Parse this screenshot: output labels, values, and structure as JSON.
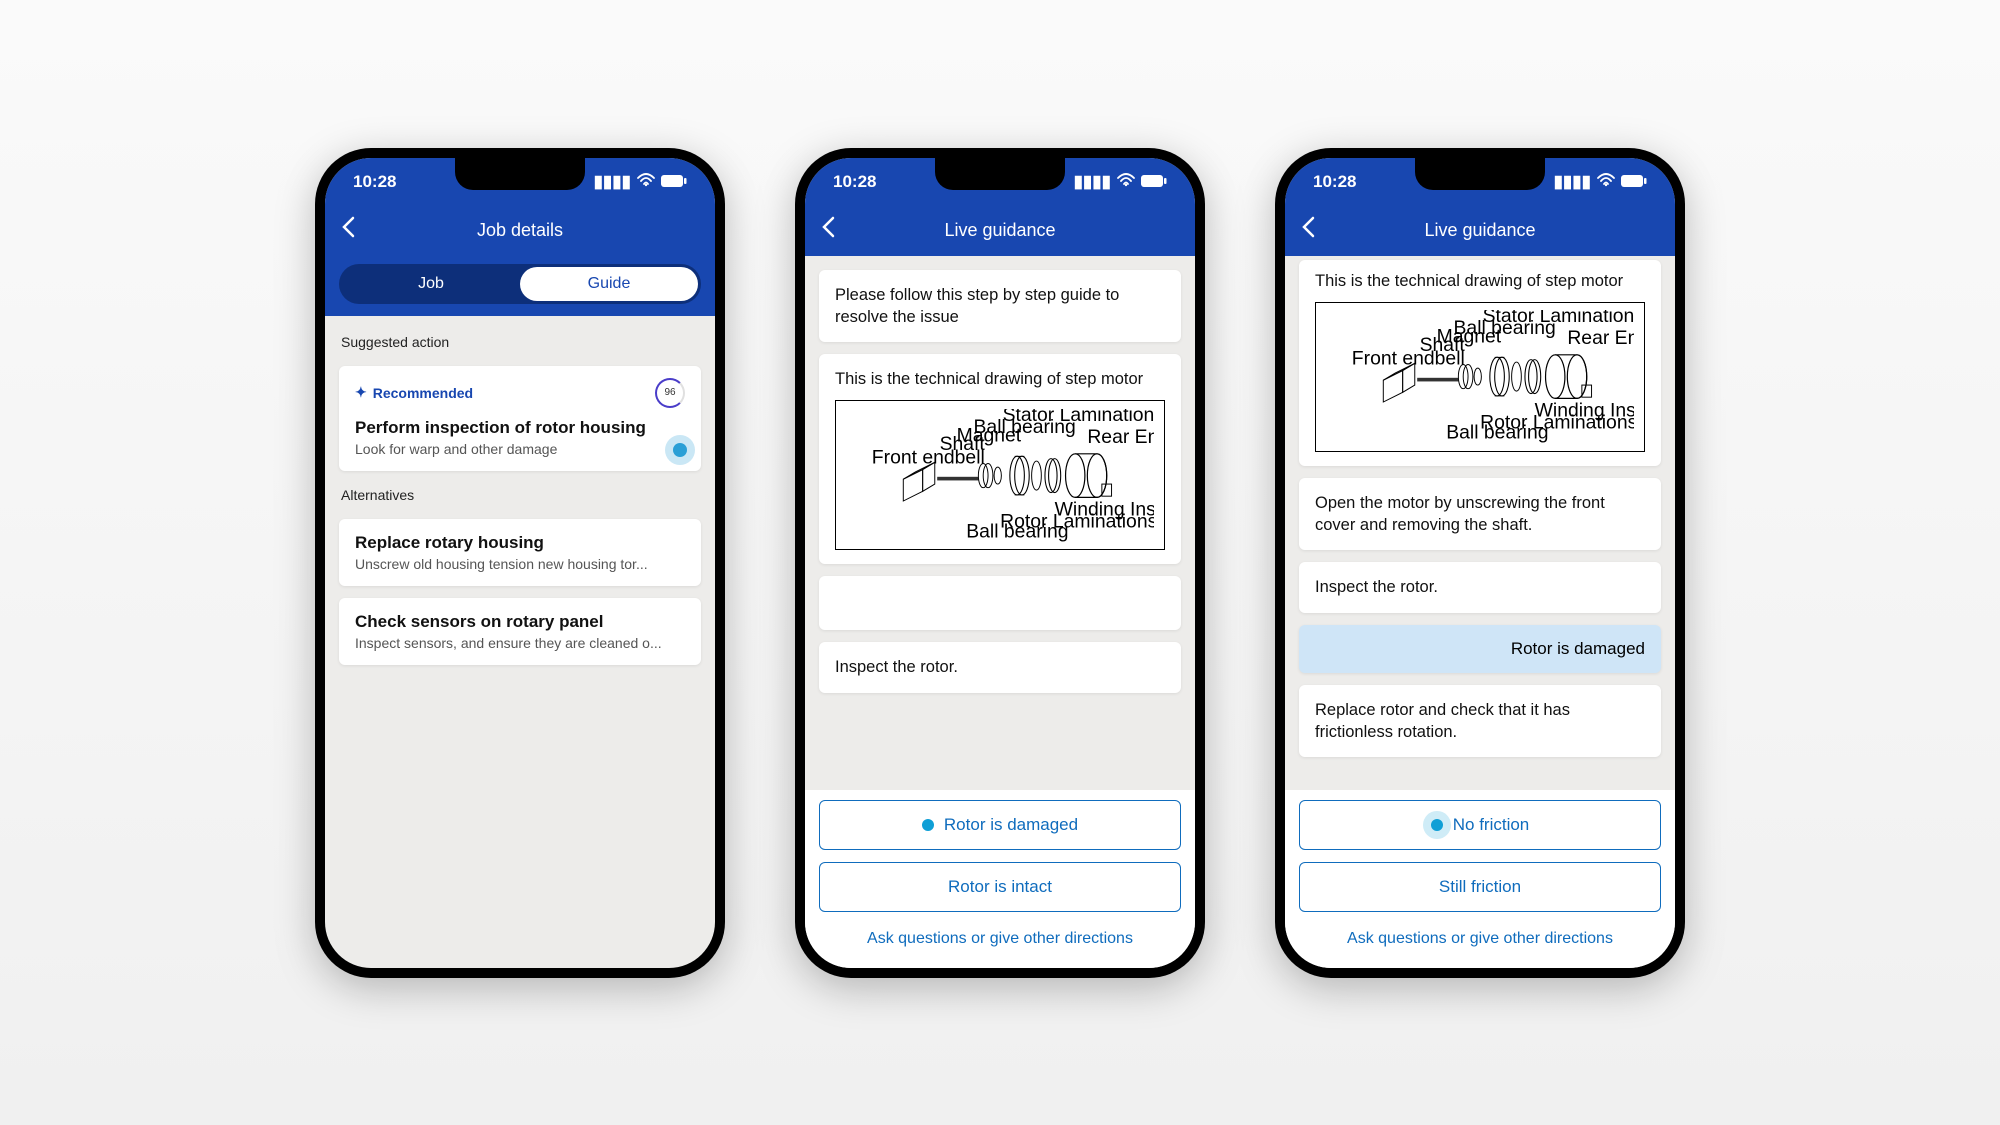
{
  "status": {
    "time": "10:28"
  },
  "phone1": {
    "header": "Job details",
    "tabs": {
      "job": "Job",
      "guide": "Guide"
    },
    "section_suggested": "Suggested action",
    "section_alt": "Alternatives",
    "recommended": {
      "badge": "Recommended",
      "score": "96",
      "title": "Perform inspection of rotor housing",
      "sub": "Look for warp and other damage"
    },
    "alts": [
      {
        "title": "Replace rotary housing",
        "sub": "Unscrew old housing tension new housing tor..."
      },
      {
        "title": "Check sensors on rotary panel",
        "sub": "Inspect sensors, and ensure they are cleaned o..."
      }
    ]
  },
  "phone2": {
    "header": "Live guidance",
    "intro": "Please follow this step by step guide to resolve the issue",
    "drawing_caption": "This is the technical drawing of step motor",
    "step": "Inspect the rotor.",
    "options": {
      "a": "Rotor is damaged",
      "b": "Rotor is intact"
    },
    "ask": "Ask questions or give other directions"
  },
  "phone3": {
    "header": "Live guidance",
    "drawing_caption": "This is the technical drawing of step motor",
    "step1": "Open the motor by unscrewing the front cover and removing the shaft.",
    "step2": "Inspect the rotor.",
    "selected": "Rotor is damaged",
    "step3": "Replace rotor and check that it has frictionless rotation.",
    "options": {
      "a": "No friction",
      "b": "Still friction"
    },
    "ask": "Ask questions or give other directions"
  },
  "drawing_labels": {
    "l1": "Stator Laminations",
    "l2": "Ball bearing",
    "l3": "Magnet",
    "l4": "Shaft",
    "l5": "Front endbell",
    "l6": "Rear Endbell",
    "l7": "Winding Insulator",
    "l8": "Rotor Laminations",
    "l9": "Ball bearing"
  }
}
